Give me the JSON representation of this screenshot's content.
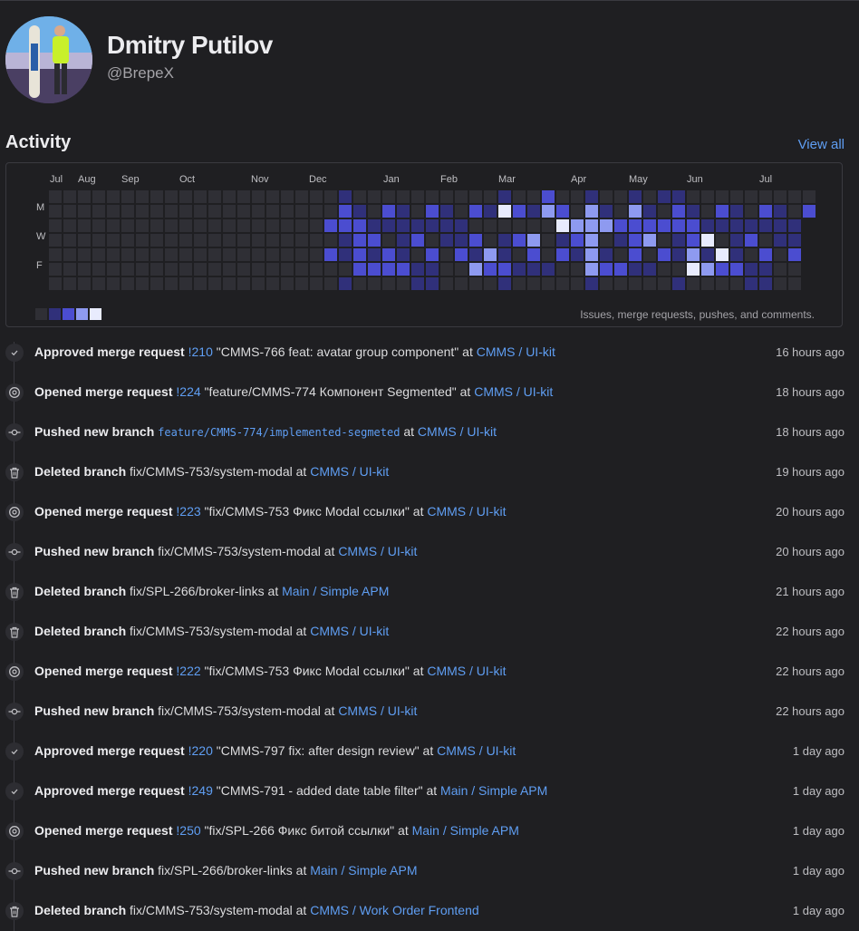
{
  "profile": {
    "name": "Dmitry Putilov",
    "handle": "@BrepeX"
  },
  "activity": {
    "title": "Activity",
    "view_all": "View all",
    "calendar": {
      "months": [
        "Jul",
        "Aug",
        "Sep",
        "Oct",
        "Nov",
        "Dec",
        "Jan",
        "Feb",
        "Mar",
        "Apr",
        "May",
        "Jun",
        "Jul"
      ],
      "day_labels": [
        "M",
        "W",
        "F"
      ],
      "note": "Issues, merge requests, pushes, and comments.",
      "level_colors": [
        "#2f2f35",
        "#30307a",
        "#4b4dd0",
        "#8e9af0",
        "#e8ebfd"
      ]
    }
  },
  "feed": [
    {
      "icon": "check-icon",
      "action": "Approved merge request",
      "ref": "!210",
      "ref_mono": false,
      "title": "\"CMMS-766 feat: avatar group component\"",
      "at": "at",
      "project": "CMMS / UI-kit",
      "time": "16 hours ago"
    },
    {
      "icon": "merge-request-open-icon",
      "action": "Opened merge request",
      "ref": "!224",
      "ref_mono": false,
      "title": "\"feature/CMMS-774 Компонент Segmented\"",
      "at": "at",
      "project": "CMMS / UI-kit",
      "time": "18 hours ago"
    },
    {
      "icon": "commit-icon",
      "action": "Pushed new branch",
      "ref": "feature/CMMS-774/implemented-segmeted",
      "ref_mono": true,
      "title": "",
      "at": "at",
      "project": "CMMS / UI-kit",
      "time": "18 hours ago"
    },
    {
      "icon": "trash-icon",
      "action": "Deleted branch",
      "ref": "fix/CMMS-753/system-modal",
      "ref_mono": false,
      "ref_plain": true,
      "title": "",
      "at": "at",
      "project": "CMMS / UI-kit",
      "time": "19 hours ago"
    },
    {
      "icon": "merge-request-open-icon",
      "action": "Opened merge request",
      "ref": "!223",
      "ref_mono": false,
      "title": "\"fix/CMMS-753 Фикс Modal ссылки\"",
      "at": "at",
      "project": "CMMS / UI-kit",
      "time": "20 hours ago"
    },
    {
      "icon": "commit-icon",
      "action": "Pushed new branch",
      "ref": "fix/CMMS-753/system-modal",
      "ref_mono": false,
      "ref_plain": true,
      "title": "",
      "at": "at",
      "project": "CMMS / UI-kit",
      "time": "20 hours ago"
    },
    {
      "icon": "trash-icon",
      "action": "Deleted branch",
      "ref": "fix/SPL-266/broker-links",
      "ref_mono": false,
      "ref_plain": true,
      "title": "",
      "at": "at",
      "project": "Main / Simple APM",
      "time": "21 hours ago"
    },
    {
      "icon": "trash-icon",
      "action": "Deleted branch",
      "ref": "fix/CMMS-753/system-modal",
      "ref_mono": false,
      "ref_plain": true,
      "title": "",
      "at": "at",
      "project": "CMMS / UI-kit",
      "time": "22 hours ago"
    },
    {
      "icon": "merge-request-open-icon",
      "action": "Opened merge request",
      "ref": "!222",
      "ref_mono": false,
      "title": "\"fix/CMMS-753 Фикс Modal ссылки\"",
      "at": "at",
      "project": "CMMS / UI-kit",
      "time": "22 hours ago"
    },
    {
      "icon": "commit-icon",
      "action": "Pushed new branch",
      "ref": "fix/CMMS-753/system-modal",
      "ref_mono": false,
      "ref_plain": true,
      "title": "",
      "at": "at",
      "project": "CMMS / UI-kit",
      "time": "22 hours ago"
    },
    {
      "icon": "check-icon",
      "action": "Approved merge request",
      "ref": "!220",
      "ref_mono": false,
      "title": "\"CMMS-797 fix: after design review\"",
      "at": "at",
      "project": "CMMS / UI-kit",
      "time": "1 day ago"
    },
    {
      "icon": "check-icon",
      "action": "Approved merge request",
      "ref": "!249",
      "ref_mono": false,
      "title": "\"CMMS-791 - added date table filter\"",
      "at": "at",
      "project": "Main / Simple APM",
      "time": "1 day ago"
    },
    {
      "icon": "merge-request-open-icon",
      "action": "Opened merge request",
      "ref": "!250",
      "ref_mono": false,
      "title": "\"fix/SPL-266 Фикс битой ссылки\"",
      "at": "at",
      "project": "Main / Simple APM",
      "time": "1 day ago"
    },
    {
      "icon": "commit-icon",
      "action": "Pushed new branch",
      "ref": "fix/SPL-266/broker-links",
      "ref_mono": false,
      "ref_plain": true,
      "title": "",
      "at": "at",
      "project": "Main / Simple APM",
      "time": "1 day ago"
    },
    {
      "icon": "trash-icon",
      "action": "Deleted branch",
      "ref": "fix/CMMS-753/system-modal",
      "ref_mono": false,
      "ref_plain": true,
      "title": "",
      "at": "at",
      "project": "CMMS / Work Order Frontend",
      "time": "1 day ago"
    }
  ]
}
